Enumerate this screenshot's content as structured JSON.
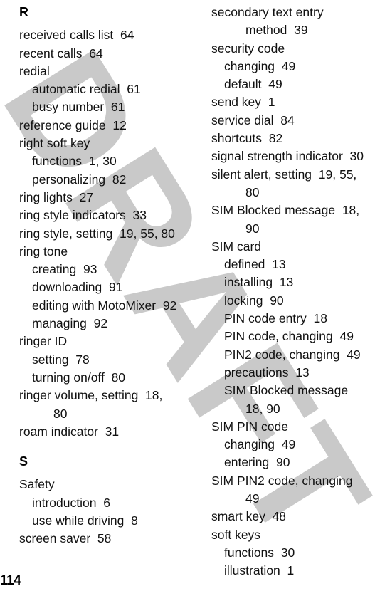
{
  "document": {
    "type": "index",
    "page_number": "114",
    "watermark": {
      "text": "DRAFT",
      "color": "#c9c9c9",
      "rotation_deg": 58
    }
  },
  "left_column": [
    {
      "kind": "letter",
      "text": "R"
    },
    {
      "kind": "entry",
      "level": 0,
      "text": "received calls list  64"
    },
    {
      "kind": "entry",
      "level": 0,
      "text": "recent calls  64"
    },
    {
      "kind": "entry",
      "level": 0,
      "text": "redial"
    },
    {
      "kind": "entry",
      "level": 1,
      "text": "automatic redial  61"
    },
    {
      "kind": "entry",
      "level": 1,
      "text": "busy number  61"
    },
    {
      "kind": "entry",
      "level": 0,
      "text": "reference guide  12"
    },
    {
      "kind": "entry",
      "level": 0,
      "text": "right soft key"
    },
    {
      "kind": "entry",
      "level": 1,
      "text": "functions  1, 30"
    },
    {
      "kind": "entry",
      "level": 1,
      "text": "personalizing  82"
    },
    {
      "kind": "entry",
      "level": 0,
      "text": "ring lights  27"
    },
    {
      "kind": "entry",
      "level": 0,
      "text": "ring style indicators  33"
    },
    {
      "kind": "entry",
      "level": 0,
      "text": "ring style, setting  19, 55, 80"
    },
    {
      "kind": "entry",
      "level": 0,
      "text": "ring tone"
    },
    {
      "kind": "entry",
      "level": 1,
      "text": "creating  93"
    },
    {
      "kind": "entry",
      "level": 1,
      "text": "downloading  91"
    },
    {
      "kind": "entry",
      "level": 1,
      "text": "editing with MotoMixer  92"
    },
    {
      "kind": "entry",
      "level": 1,
      "text": "managing  92"
    },
    {
      "kind": "entry",
      "level": 0,
      "text": "ringer ID"
    },
    {
      "kind": "entry",
      "level": 1,
      "text": "setting  78"
    },
    {
      "kind": "entry",
      "level": 1,
      "text": "turning on/off  80"
    },
    {
      "kind": "entry",
      "level": 0,
      "text": "ringer volume, setting  18,"
    },
    {
      "kind": "cont",
      "text": "80"
    },
    {
      "kind": "entry",
      "level": 0,
      "text": "roam indicator  31"
    },
    {
      "kind": "letter",
      "text": "S"
    },
    {
      "kind": "entry",
      "level": 0,
      "text": "Safety"
    },
    {
      "kind": "entry",
      "level": 1,
      "text": "introduction  6"
    },
    {
      "kind": "entry",
      "level": 1,
      "text": "use while driving  8"
    },
    {
      "kind": "entry",
      "level": 0,
      "text": "screen saver  58"
    }
  ],
  "right_column": [
    {
      "kind": "entry",
      "level": 0,
      "text": "secondary text entry"
    },
    {
      "kind": "cont",
      "text": "method  39"
    },
    {
      "kind": "entry",
      "level": 0,
      "text": "security code"
    },
    {
      "kind": "entry",
      "level": 1,
      "text": "changing  49"
    },
    {
      "kind": "entry",
      "level": 1,
      "text": "default  49"
    },
    {
      "kind": "entry",
      "level": 0,
      "text": "send key  1"
    },
    {
      "kind": "entry",
      "level": 0,
      "text": "service dial  84"
    },
    {
      "kind": "entry",
      "level": 0,
      "text": "shortcuts  82"
    },
    {
      "kind": "entry",
      "level": 0,
      "text": "signal strength indicator  30"
    },
    {
      "kind": "entry",
      "level": 0,
      "text": "silent alert, setting  19, 55,"
    },
    {
      "kind": "cont",
      "text": "80"
    },
    {
      "kind": "entry",
      "level": 0,
      "text": "SIM Blocked message  18,"
    },
    {
      "kind": "cont",
      "text": "90"
    },
    {
      "kind": "entry",
      "level": 0,
      "text": "SIM card"
    },
    {
      "kind": "entry",
      "level": 1,
      "text": "defined  13"
    },
    {
      "kind": "entry",
      "level": 1,
      "text": "installing  13"
    },
    {
      "kind": "entry",
      "level": 1,
      "text": "locking  90"
    },
    {
      "kind": "entry",
      "level": 1,
      "text": "PIN code entry  18"
    },
    {
      "kind": "entry",
      "level": 1,
      "text": "PIN code, changing  49"
    },
    {
      "kind": "entry",
      "level": 1,
      "text": "PIN2 code, changing  49"
    },
    {
      "kind": "entry",
      "level": 1,
      "text": "precautions  13"
    },
    {
      "kind": "entry",
      "level": 1,
      "text": "SIM Blocked message"
    },
    {
      "kind": "cont",
      "text": "18, 90"
    },
    {
      "kind": "entry",
      "level": 0,
      "text": "SIM PIN code"
    },
    {
      "kind": "entry",
      "level": 1,
      "text": "changing  49"
    },
    {
      "kind": "entry",
      "level": 1,
      "text": "entering  90"
    },
    {
      "kind": "entry",
      "level": 0,
      "text": "SIM PIN2 code, changing"
    },
    {
      "kind": "cont",
      "text": "49"
    },
    {
      "kind": "entry",
      "level": 0,
      "text": "smart key  48"
    },
    {
      "kind": "entry",
      "level": 0,
      "text": "soft keys"
    },
    {
      "kind": "entry",
      "level": 1,
      "text": "functions  30"
    },
    {
      "kind": "entry",
      "level": 1,
      "text": "illustration  1"
    }
  ]
}
